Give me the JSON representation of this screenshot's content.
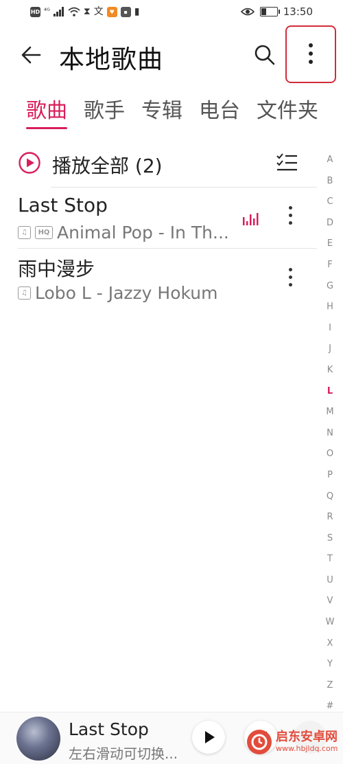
{
  "status_bar": {
    "left_icons": [
      "HD",
      "4G",
      "signal",
      "wifi",
      "hourglass",
      "translate",
      "app1",
      "app2",
      "battery-alert"
    ],
    "time": "13:50"
  },
  "header": {
    "title": "本地歌曲",
    "back_icon": "back-arrow-icon",
    "search_icon": "search-icon",
    "more_icon": "more-vertical-icon"
  },
  "tabs": [
    "歌曲",
    "歌手",
    "专辑",
    "电台",
    "文件夹"
  ],
  "play_all": {
    "label": "播放全部",
    "count": "(2)"
  },
  "songs": [
    {
      "title": "Last Stop",
      "subtitle": "Animal Pop - In Th...",
      "hq": "HQ",
      "playing": true
    },
    {
      "title": "雨中漫步",
      "subtitle": "Lobo L - Jazzy Hokum",
      "hq": "",
      "playing": false
    }
  ],
  "alpha_index": [
    "A",
    "B",
    "C",
    "D",
    "E",
    "F",
    "G",
    "H",
    "I",
    "J",
    "K",
    "L",
    "M",
    "N",
    "O",
    "P",
    "Q",
    "R",
    "S",
    "T",
    "U",
    "V",
    "W",
    "X",
    "Y",
    "Z",
    "#"
  ],
  "alpha_active": "L",
  "mini_player": {
    "title": "Last Stop",
    "subtitle": "左右滑动可切换..."
  },
  "watermark": {
    "main": "启东安卓网",
    "sub": "www.hbjldq.com"
  },
  "colors": {
    "accent": "#d81e5b",
    "highlight_border": "#d22b3a"
  }
}
